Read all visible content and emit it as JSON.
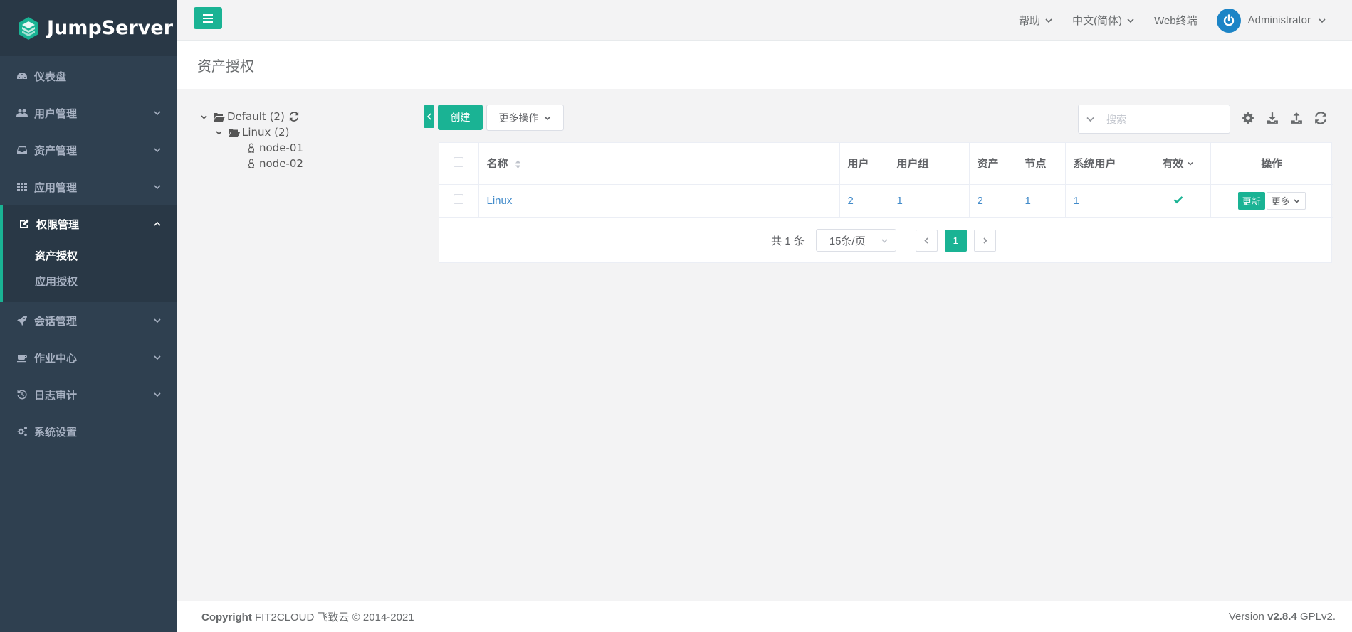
{
  "brand": {
    "name": "JumpServer"
  },
  "sidebar": {
    "items": [
      {
        "label": "仪表盘",
        "icon": "dashboard-icon"
      },
      {
        "label": "用户管理",
        "icon": "users-icon"
      },
      {
        "label": "资产管理",
        "icon": "inbox-icon"
      },
      {
        "label": "应用管理",
        "icon": "grid-icon"
      },
      {
        "label": "权限管理",
        "icon": "edit-icon",
        "expanded": true,
        "children": [
          {
            "label": "资产授权",
            "current": true
          },
          {
            "label": "应用授权"
          }
        ]
      },
      {
        "label": "会话管理",
        "icon": "rocket-icon"
      },
      {
        "label": "作业中心",
        "icon": "coffee-icon"
      },
      {
        "label": "日志审计",
        "icon": "history-icon"
      },
      {
        "label": "系统设置",
        "icon": "cogs-icon"
      }
    ]
  },
  "topbar": {
    "help": "帮助",
    "language": "中文(简体)",
    "web_terminal": "Web终端",
    "user": "Administrator"
  },
  "page": {
    "title": "资产授权"
  },
  "tree": {
    "root": "Default (2)",
    "child": "Linux (2)",
    "leaves": [
      "node-01",
      "node-02"
    ]
  },
  "toolbar": {
    "create": "创建",
    "more_ops": "更多操作",
    "search_placeholder": "搜索"
  },
  "table": {
    "headers": {
      "name": "名称",
      "users": "用户",
      "user_groups": "用户组",
      "assets": "资产",
      "nodes": "节点",
      "system_users": "系统用户",
      "active": "有效",
      "actions": "操作"
    },
    "rows": [
      {
        "name": "Linux",
        "users": "2",
        "user_groups": "1",
        "assets": "2",
        "nodes": "1",
        "system_users": "1",
        "active": true,
        "update": "更新",
        "more": "更多"
      }
    ]
  },
  "pagination": {
    "total": "共 1 条",
    "page_size": "15条/页",
    "current": "1"
  },
  "footer": {
    "copyright_label": "Copyright",
    "copyright_text": "FIT2CLOUD 飞致云 © 2014-2021",
    "version_label": "Version",
    "version": "v2.8.4",
    "license": "GPLv2."
  },
  "colors": {
    "accent": "#1ab394",
    "sidebar": "#2f4050",
    "link": "#428bca",
    "avatar": "#1c84c6"
  }
}
